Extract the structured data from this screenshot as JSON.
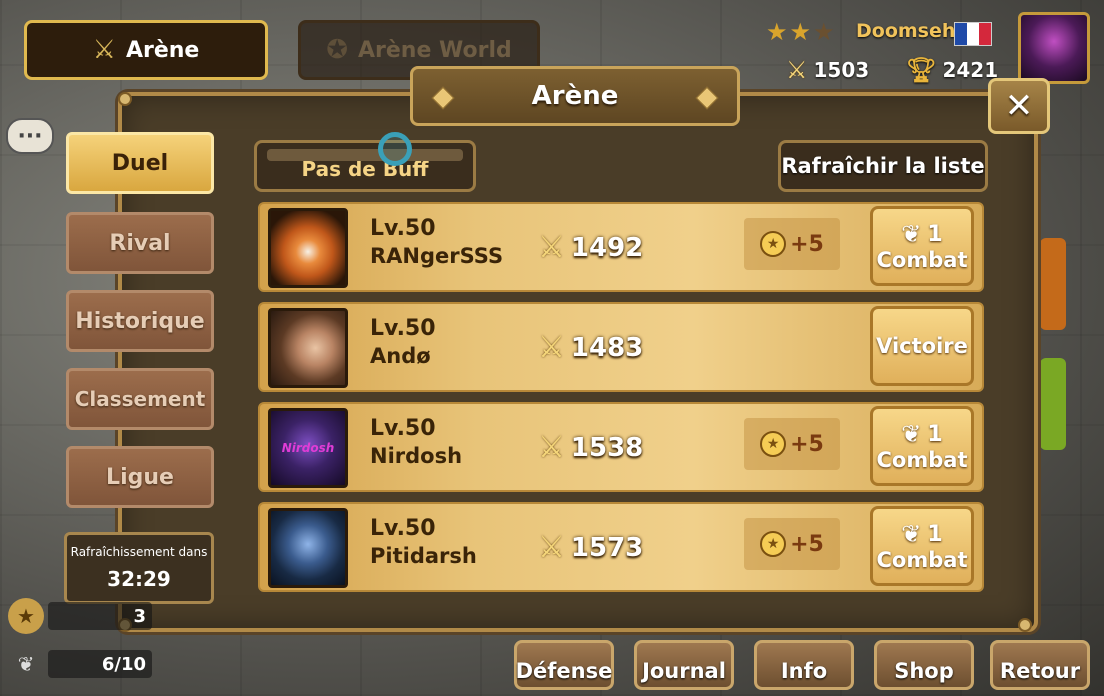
{
  "top_tabs": [
    {
      "label": "Arène",
      "icon": "crossed-swords-laurel-icon",
      "active": true
    },
    {
      "label": "Arène World",
      "icon": "globe-swords-icon",
      "active": false
    }
  ],
  "player": {
    "stars_filled": 2,
    "stars_total": 3,
    "name": "Doomseh",
    "flag": "france",
    "score": "1503",
    "trophies": "2421"
  },
  "panel": {
    "title": "Arène",
    "close_label": "✕"
  },
  "side_menu": [
    {
      "label": "Duel",
      "active": true
    },
    {
      "label": "Rival",
      "active": false
    },
    {
      "label": "Historique",
      "active": false
    },
    {
      "label": "Classement",
      "active": false
    },
    {
      "label": "Ligue",
      "active": false
    }
  ],
  "refresh_timer": {
    "label": "Rafraîchissement dans",
    "value": "32:29"
  },
  "buff_button": "Pas de Buff",
  "refresh_list_button": "Rafraîchir la liste",
  "opponents": [
    {
      "level": "Lv.50",
      "name": "RANgerSSS",
      "score": "1492",
      "reward": "+5",
      "cost": "1",
      "action": "Combat",
      "portrait": "fox"
    },
    {
      "level": "Lv.50",
      "name": "Andø",
      "score": "1483",
      "reward": null,
      "cost": null,
      "action": "Victoire",
      "portrait": "face"
    },
    {
      "level": "Lv.50",
      "name": "Nirdosh",
      "score": "1538",
      "reward": "+5",
      "cost": "1",
      "action": "Combat",
      "portrait": "nirdosh-logo",
      "portrait_text": "Nirdosh"
    },
    {
      "level": "Lv.50",
      "name": "Pitidarsh",
      "score": "1573",
      "reward": "+5",
      "cost": "1",
      "action": "Combat",
      "portrait": "winged-warrior"
    }
  ],
  "energy": [
    {
      "icon": "medal-icon",
      "value": "3"
    },
    {
      "icon": "wing-icon",
      "value": "6/10"
    }
  ],
  "bottom_nav": [
    {
      "label": "Défense"
    },
    {
      "label": "Journal"
    },
    {
      "label": "Info"
    },
    {
      "label": "Shop"
    },
    {
      "label": "Retour"
    }
  ],
  "colors": {
    "gold": "#f1c35b",
    "panel_bg": "#4a3d28",
    "row_gold": "#e8c479",
    "active_tab": "#d9a73f"
  }
}
